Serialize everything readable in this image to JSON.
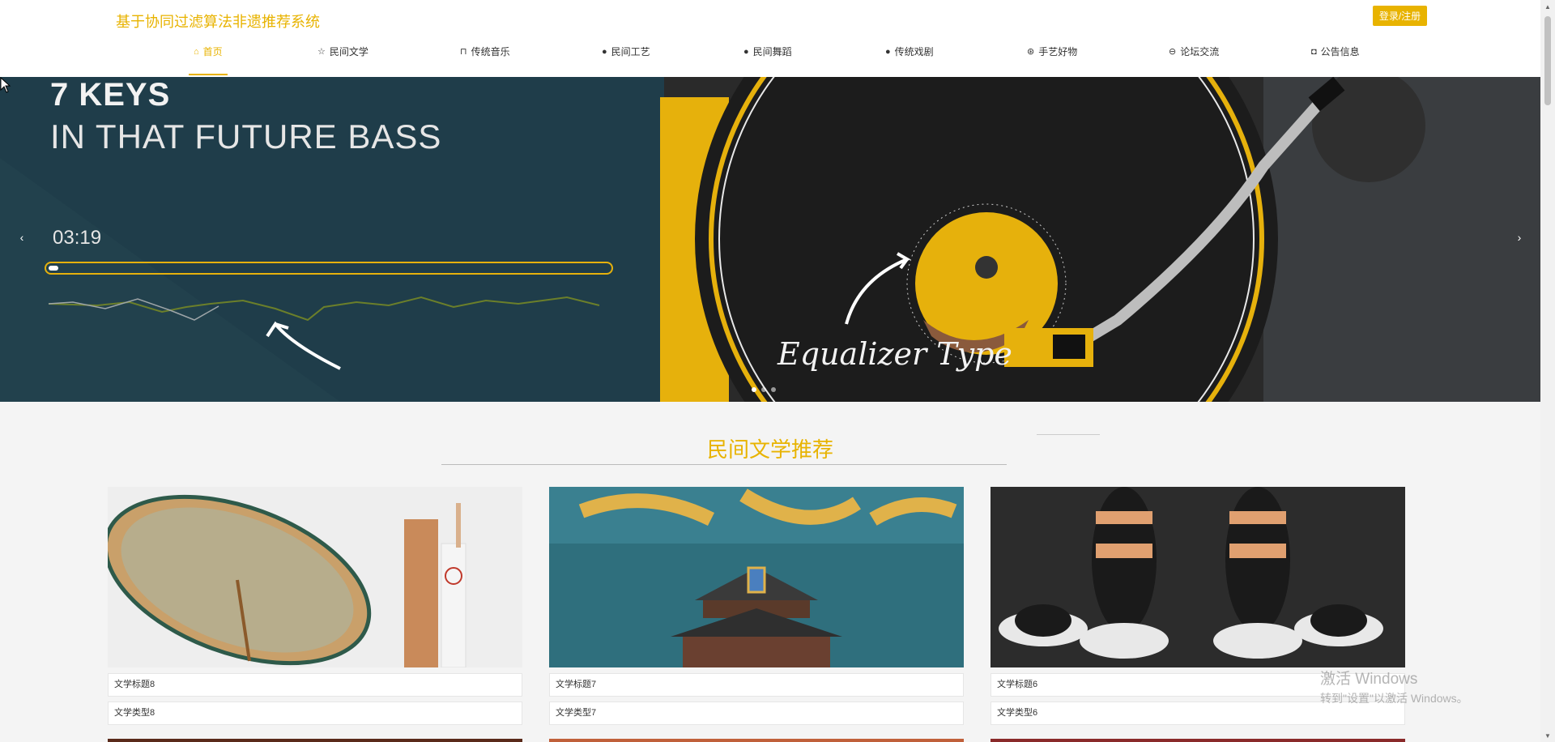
{
  "header": {
    "site_title": "基于协同过滤算法非遗推荐系统",
    "login_button": "登录/注册"
  },
  "nav": {
    "items": [
      {
        "label": "首页",
        "icon": "home-icon",
        "glyph": "⌂"
      },
      {
        "label": "民间文学",
        "icon": "star-icon",
        "glyph": "☆"
      },
      {
        "label": "传统音乐",
        "icon": "bag-icon",
        "glyph": "⊓"
      },
      {
        "label": "民间工艺",
        "icon": "info-icon",
        "glyph": "●"
      },
      {
        "label": "民间舞蹈",
        "icon": "question-icon",
        "glyph": "●"
      },
      {
        "label": "传统戏剧",
        "icon": "info-icon",
        "glyph": "●"
      },
      {
        "label": "手艺好物",
        "icon": "settings-icon",
        "glyph": "⊛"
      },
      {
        "label": "论坛交流",
        "icon": "chat-icon",
        "glyph": "⊖"
      },
      {
        "label": "公告信息",
        "icon": "camera-icon",
        "glyph": "◘"
      }
    ]
  },
  "banner": {
    "line1": "7 KEYS",
    "line2": "IN THAT FUTURE BASS",
    "time": "03:19",
    "caption": "Equalizer Type",
    "prev_glyph": "‹",
    "next_glyph": "›"
  },
  "section": {
    "title": "民间文学推荐"
  },
  "cards": [
    {
      "title": "文学标题8",
      "type": "文学类型8"
    },
    {
      "title": "文学标题7",
      "type": "文学类型7"
    },
    {
      "title": "文学标题6",
      "type": "文学类型6"
    }
  ],
  "watermark": {
    "line1": "激活 Windows",
    "line2": "转到\"设置\"以激活 Windows。"
  },
  "colors": {
    "accent": "#e8b300",
    "banner_dark": "#1f3d4a"
  }
}
